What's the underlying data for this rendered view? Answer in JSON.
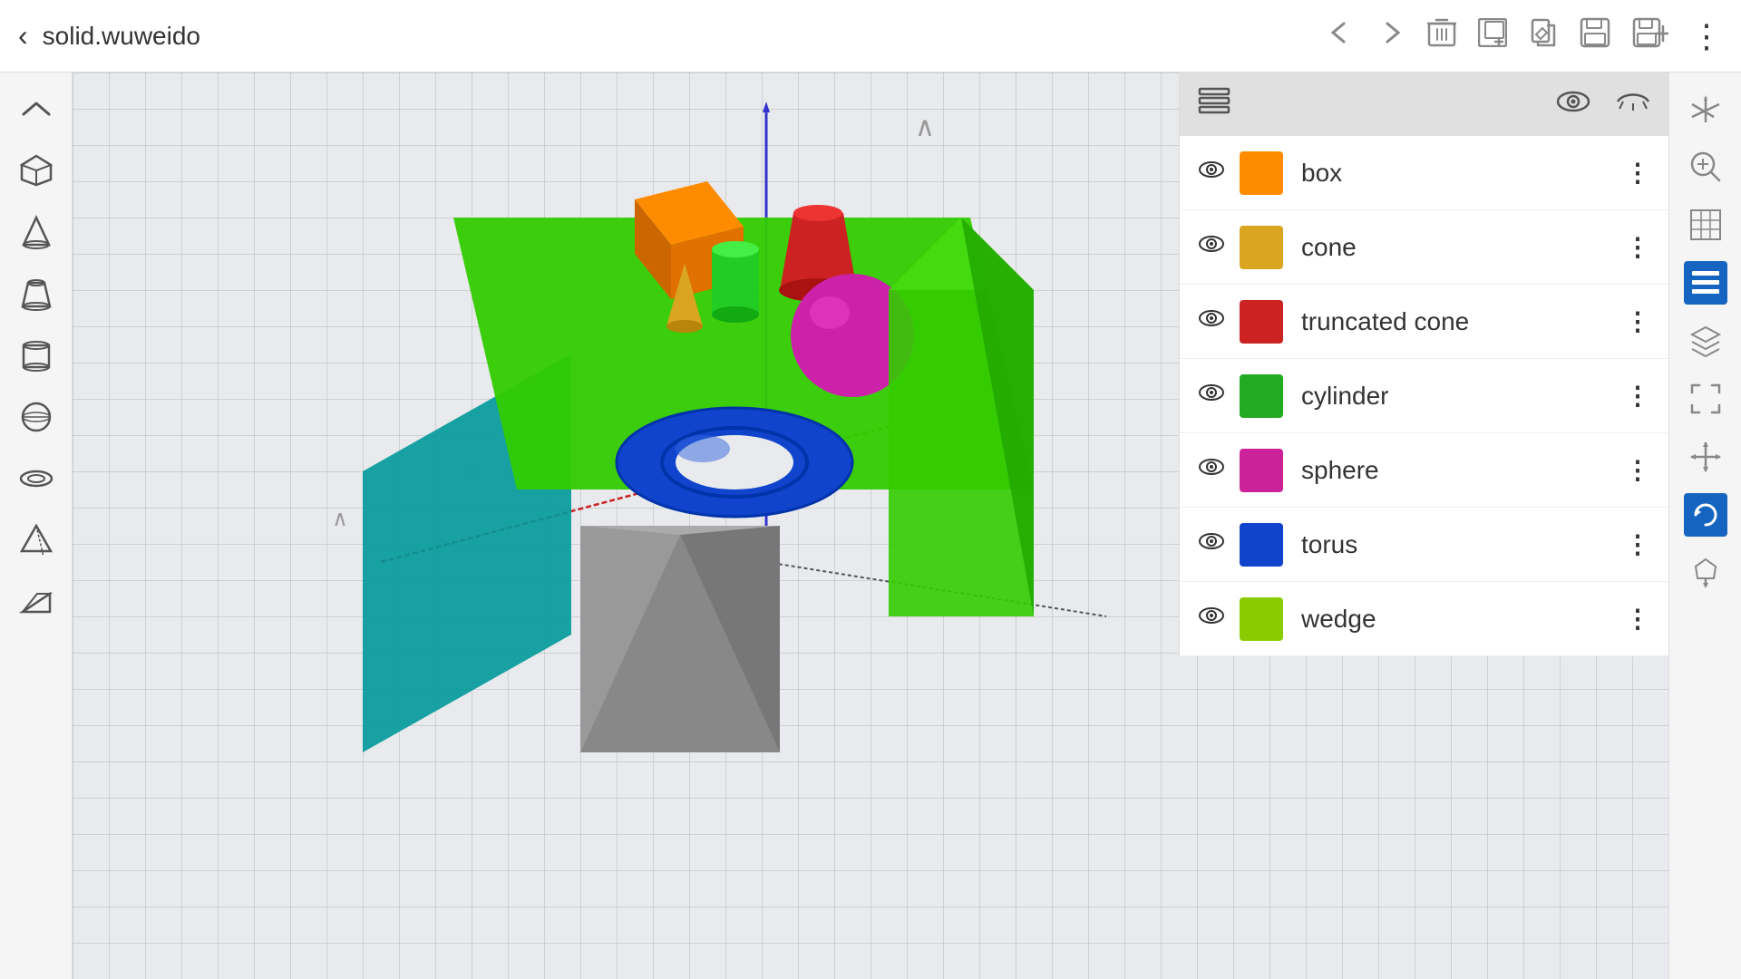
{
  "app": {
    "title": "solid.wuweido"
  },
  "topbar": {
    "back_label": "‹",
    "title": "solid.wuweido",
    "nav_back": "←",
    "nav_forward": "→",
    "delete_icon": "🗑",
    "add_icon": "⊞",
    "edit_icon": "✏",
    "save_icon": "💾",
    "save_plus_icon": "💾+",
    "more_icon": "⋮"
  },
  "left_sidebar": {
    "items": [
      {
        "name": "collapse-up",
        "icon": "∧"
      },
      {
        "name": "cube",
        "icon": "⬜"
      },
      {
        "name": "cone",
        "icon": "△"
      },
      {
        "name": "truncated-cone",
        "icon": "⏣"
      },
      {
        "name": "cylinder",
        "icon": "⊓"
      },
      {
        "name": "sphere-icon",
        "icon": "⊙"
      },
      {
        "name": "torus-icon",
        "icon": "◎"
      },
      {
        "name": "prism-icon",
        "icon": "◁"
      },
      {
        "name": "wedge-icon",
        "icon": "◇"
      }
    ]
  },
  "right_sidebar": {
    "items": [
      {
        "name": "axes-icon",
        "icon": "⊹",
        "active": false
      },
      {
        "name": "search-3d-icon",
        "icon": "⊕",
        "active": false
      },
      {
        "name": "grid-icon",
        "icon": "⊞",
        "active": false
      },
      {
        "name": "layers-icon",
        "icon": "≡",
        "active": true
      },
      {
        "name": "stack-icon",
        "icon": "◈",
        "active": false
      },
      {
        "name": "frame-icon",
        "icon": "⊡",
        "active": false
      },
      {
        "name": "move-icon",
        "icon": "✛",
        "active": false
      },
      {
        "name": "rotate-icon",
        "icon": "↻",
        "active": true
      },
      {
        "name": "transform-icon",
        "icon": "⇱",
        "active": false
      }
    ]
  },
  "layer_panel": {
    "header": {
      "icon": "≡",
      "eye_icon": "👁",
      "closed_eye_icon": "—"
    },
    "items": [
      {
        "name": "box",
        "label": "box",
        "color": "#FF8C00",
        "visible": true
      },
      {
        "name": "cone",
        "label": "cone",
        "color": "#DAA520",
        "visible": true
      },
      {
        "name": "truncated_cone",
        "label": "truncated cone",
        "color": "#CC2222",
        "visible": true
      },
      {
        "name": "cylinder",
        "label": "cylinder",
        "color": "#22AA22",
        "visible": true
      },
      {
        "name": "sphere",
        "label": "sphere",
        "color": "#CC2299",
        "visible": true
      },
      {
        "name": "torus",
        "label": "torus",
        "color": "#1144CC",
        "visible": true
      },
      {
        "name": "wedge",
        "label": "wedge",
        "color": "#88CC00",
        "visible": true
      }
    ]
  }
}
